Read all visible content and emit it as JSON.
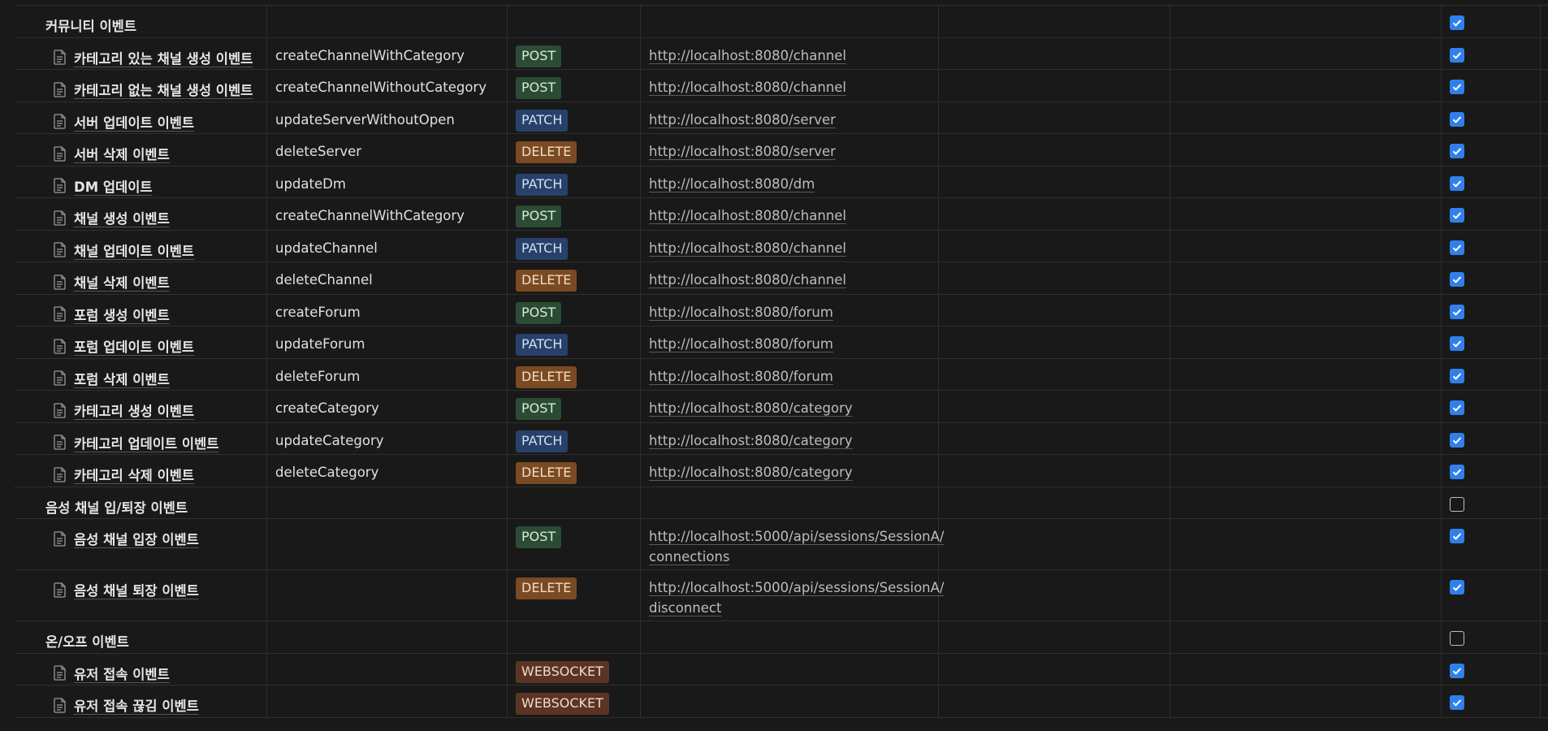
{
  "colors": {
    "POST": {
      "bg": "#2c4b35",
      "fg": "#d8e8db"
    },
    "PATCH": {
      "bg": "#28416b",
      "fg": "#d2ddf0"
    },
    "DELETE": {
      "bg": "#7a4a22",
      "fg": "#f0dcc7"
    },
    "WEBSOCKET": {
      "bg": "#5b3424",
      "fg": "#efd9cf"
    }
  },
  "rows": [
    {
      "kind": "group",
      "title": "커뮤니티 이벤트",
      "checked": true
    },
    {
      "kind": "page",
      "title": "카테고리 있는 채널 생성 이벤트",
      "fn": "createChannelWithCategory",
      "method": "POST",
      "url": "http://localhost:8080/channel",
      "checked": true
    },
    {
      "kind": "page",
      "title": "카테고리 없는 채널 생성 이벤트",
      "fn": "createChannelWithoutCategory",
      "method": "POST",
      "url": "http://localhost:8080/channel",
      "checked": true
    },
    {
      "kind": "page",
      "title": "서버 업데이트 이벤트",
      "fn": "updateServerWithoutOpen",
      "method": "PATCH",
      "url": "http://localhost:8080/server",
      "checked": true
    },
    {
      "kind": "page",
      "title": "서버 삭제 이벤트",
      "fn": "deleteServer",
      "method": "DELETE",
      "url": "http://localhost:8080/server",
      "checked": true
    },
    {
      "kind": "page",
      "title": "DM 업데이트",
      "fn": "updateDm",
      "method": "PATCH",
      "url": "http://localhost:8080/dm",
      "checked": true
    },
    {
      "kind": "page",
      "title": "채널 생성 이벤트",
      "fn": "createChannelWithCategory",
      "method": "POST",
      "url": "http://localhost:8080/channel",
      "checked": true
    },
    {
      "kind": "page",
      "title": "채널 업데이트 이벤트",
      "fn": "updateChannel",
      "method": "PATCH",
      "url": "http://localhost:8080/channel",
      "checked": true
    },
    {
      "kind": "page",
      "title": "채널 삭제 이벤트",
      "fn": "deleteChannel",
      "method": "DELETE",
      "url": "http://localhost:8080/channel",
      "checked": true
    },
    {
      "kind": "page",
      "title": "포럼 생성 이벤트",
      "fn": "createForum",
      "method": "POST",
      "url": "http://localhost:8080/forum",
      "checked": true
    },
    {
      "kind": "page",
      "title": "포럼 업데이트 이벤트",
      "fn": "updateForum",
      "method": "PATCH",
      "url": "http://localhost:8080/forum",
      "checked": true
    },
    {
      "kind": "page",
      "title": "포럼 삭제 이벤트",
      "fn": "deleteForum",
      "method": "DELETE",
      "url": "http://localhost:8080/forum",
      "checked": true
    },
    {
      "kind": "page",
      "title": "카테고리 생성 이벤트",
      "fn": "createCategory",
      "method": "POST",
      "url": "http://localhost:8080/category",
      "checked": true
    },
    {
      "kind": "page",
      "title": "카테고리 업데이트 이벤트",
      "fn": "updateCategory",
      "method": "PATCH",
      "url": "http://localhost:8080/category",
      "checked": true
    },
    {
      "kind": "page",
      "title": "카테고리 삭제 이벤트",
      "fn": "deleteCategory",
      "method": "DELETE",
      "url": "http://localhost:8080/category",
      "checked": true
    },
    {
      "kind": "group",
      "title": "음성 채널 입/퇴장 이벤트",
      "checked": false
    },
    {
      "kind": "page",
      "title": "음성 채널 입장 이벤트",
      "fn": "",
      "method": "POST",
      "url": "http://localhost:5000/api/sessions/SessionA/connections",
      "url_lines": [
        "http://localhost:5000/api/sessions/SessionA/",
        "connections"
      ],
      "checked": true
    },
    {
      "kind": "page",
      "title": "음성 채널 퇴장 이벤트",
      "fn": "",
      "method": "DELETE",
      "url": "http://localhost:5000/api/sessions/SessionA/disconnect",
      "url_lines": [
        "http://localhost:5000/api/sessions/SessionA/",
        "disconnect"
      ],
      "checked": true
    },
    {
      "kind": "group",
      "title": "온/오프 이벤트",
      "checked": false
    },
    {
      "kind": "page",
      "title": "유저 접속 이벤트",
      "fn": "",
      "method": "WEBSOCKET",
      "url": "",
      "checked": true
    },
    {
      "kind": "page",
      "title": "유저 접속 끊김 이벤트",
      "fn": "",
      "method": "WEBSOCKET",
      "url": "",
      "checked": true
    }
  ]
}
